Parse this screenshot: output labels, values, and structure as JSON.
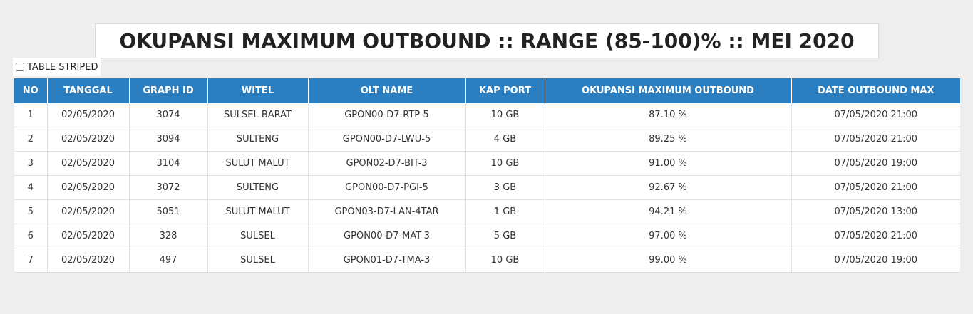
{
  "title": "OKUPANSI MAXIMUM OUTBOUND :: RANGE (85-100)% :: MEI 2020",
  "striped_toggle": {
    "label": "TABLE STRIPED",
    "checked": false
  },
  "table": {
    "headers": [
      "NO",
      "TANGGAL",
      "GRAPH ID",
      "WITEL",
      "OLT NAME",
      "KAP PORT",
      "OKUPANSI MAXIMUM OUTBOUND",
      "DATE OUTBOUND MAX"
    ],
    "rows": [
      [
        "1",
        "02/05/2020",
        "3074",
        "SULSEL BARAT",
        "GPON00-D7-RTP-5",
        "10 GB",
        "87.10 %",
        "07/05/2020 21:00"
      ],
      [
        "2",
        "02/05/2020",
        "3094",
        "SULTENG",
        "GPON00-D7-LWU-5",
        "4 GB",
        "89.25 %",
        "07/05/2020 21:00"
      ],
      [
        "3",
        "02/05/2020",
        "3104",
        "SULUT MALUT",
        "GPON02-D7-BIT-3",
        "10 GB",
        "91.00 %",
        "07/05/2020 19:00"
      ],
      [
        "4",
        "02/05/2020",
        "3072",
        "SULTENG",
        "GPON00-D7-PGI-5",
        "3 GB",
        "92.67 %",
        "07/05/2020 21:00"
      ],
      [
        "5",
        "02/05/2020",
        "5051",
        "SULUT MALUT",
        "GPON03-D7-LAN-4TAR",
        "1 GB",
        "94.21 %",
        "07/05/2020 13:00"
      ],
      [
        "6",
        "02/05/2020",
        "328",
        "SULSEL",
        "GPON00-D7-MAT-3",
        "5 GB",
        "97.00 %",
        "07/05/2020 21:00"
      ],
      [
        "7",
        "02/05/2020",
        "497",
        "SULSEL",
        "GPON01-D7-TMA-3",
        "10 GB",
        "99.00 %",
        "07/05/2020 19:00"
      ]
    ]
  },
  "colors": {
    "header_bg": "#2b7fc1",
    "page_bg": "#eeeeee"
  }
}
